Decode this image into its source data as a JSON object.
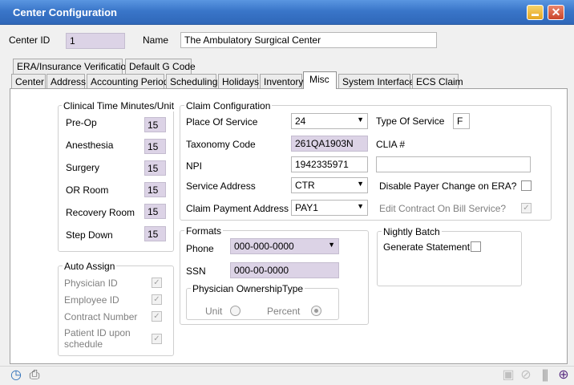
{
  "window": {
    "title": "Center Configuration",
    "minimize_glyph": "▬",
    "close_glyph": "✕"
  },
  "header": {
    "center_id_label": "Center ID",
    "center_id_value": "1",
    "name_label": "Name",
    "name_value": "The Ambulatory Surgical  Center"
  },
  "tabs_row1": [
    "ERA/Insurance Verification",
    "Default G Code"
  ],
  "tabs_row2": [
    "Center",
    "Address",
    "Accounting Period",
    "Scheduling",
    "Holidays",
    "Inventory",
    "Misc",
    "System Interface",
    "ECS Claim"
  ],
  "active_tab": "Misc",
  "clinical_time": {
    "title": "Clinical Time Minutes/Unit",
    "rows": [
      {
        "label": "Pre-Op",
        "value": "15"
      },
      {
        "label": "Anesthesia",
        "value": "15"
      },
      {
        "label": "Surgery",
        "value": "15"
      },
      {
        "label": "OR Room",
        "value": "15"
      },
      {
        "label": "Recovery Room",
        "value": "15"
      },
      {
        "label": "Step Down",
        "value": "15"
      }
    ]
  },
  "auto_assign": {
    "title": "Auto Assign",
    "items": [
      {
        "label": "Physician ID",
        "checked": true
      },
      {
        "label": "Employee ID",
        "checked": true
      },
      {
        "label": "Contract Number",
        "checked": true
      },
      {
        "label": "Patient ID upon schedule",
        "checked": true
      }
    ]
  },
  "claim_config": {
    "title": "Claim Configuration",
    "place_of_service_label": "Place Of Service",
    "place_of_service_value": "24",
    "type_of_service_label": "Type Of Service",
    "type_of_service_value": "F",
    "taxonomy_label": "Taxonomy Code",
    "taxonomy_value": "261QA1903N",
    "clia_label": "CLIA #",
    "clia_value": "",
    "npi_label": "NPI",
    "npi_value": "1942335971",
    "service_address_label": "Service Address",
    "service_address_value": "CTR",
    "disable_payer_label": "Disable Payer Change on ERA?",
    "disable_payer_checked": false,
    "claim_payment_label": "Claim Payment Address",
    "claim_payment_value": "PAY1",
    "edit_contract_label": "Edit Contract On Bill Service?",
    "edit_contract_checked": true
  },
  "formats": {
    "title": "Formats",
    "phone_label": "Phone",
    "phone_value": "000-000-0000",
    "ssn_label": "SSN",
    "ssn_value": "000-00-0000",
    "ownership": {
      "title": "Physician OwnershipType",
      "unit_label": "Unit",
      "percent_label": "Percent",
      "selected": "Percent"
    }
  },
  "nightly_batch": {
    "title": "Nightly Batch",
    "generate_label": "Generate Statement",
    "generate_checked": false
  },
  "icons": {
    "clock": "clock-icon",
    "printer": "printer-icon",
    "save": "save-icon",
    "cancel": "cancel-icon",
    "grip": "grip-icon",
    "add": "add-icon"
  },
  "colors": {
    "title_bar": "#3a76c9",
    "field_purple": "#dcd3e6"
  }
}
